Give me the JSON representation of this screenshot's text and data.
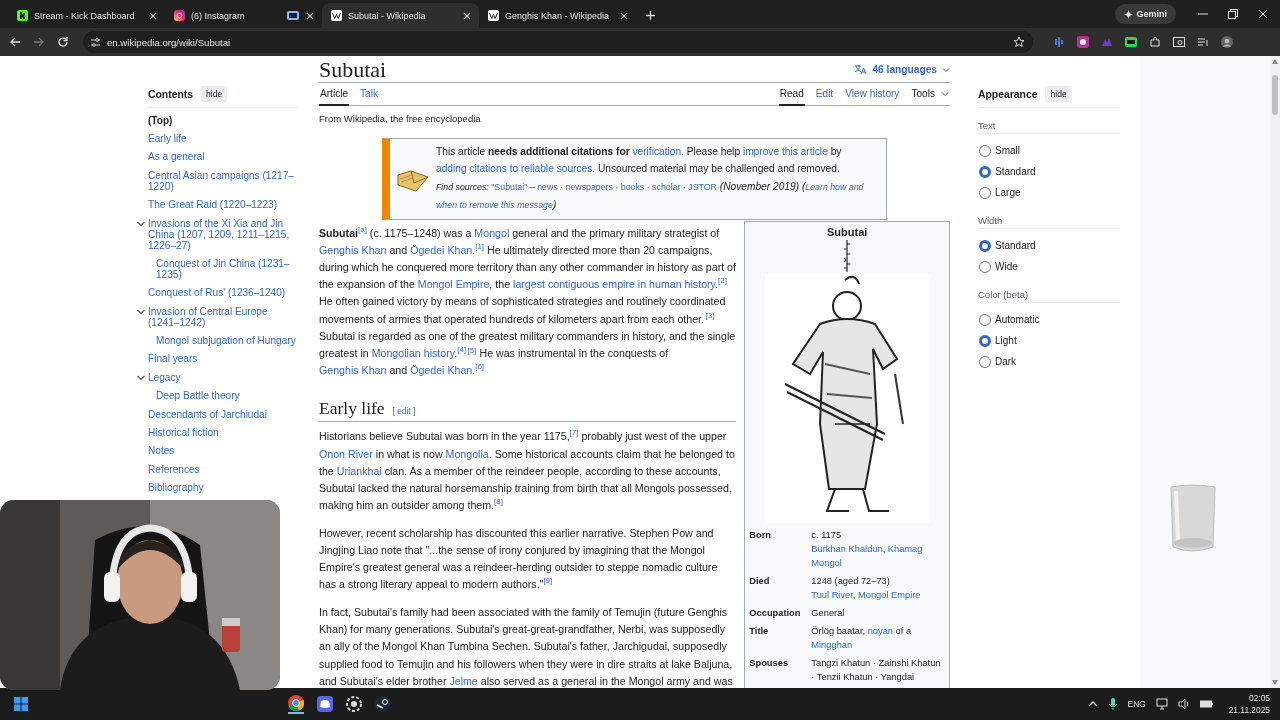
{
  "browser": {
    "tabs": [
      {
        "kind": "kick",
        "title": "Stream - Kick Dashboard",
        "selected": false,
        "sharing": false
      },
      {
        "kind": "instagram",
        "title": "(6) Instagram",
        "selected": false,
        "sharing": true
      },
      {
        "kind": "wikipedia",
        "title": "Subutai - Wikipedia",
        "selected": true,
        "sharing": false
      },
      {
        "kind": "wikipedia",
        "title": "Genghis Khan - Wikipedia",
        "selected": false,
        "sharing": false
      }
    ],
    "assistant_button": "Gemini",
    "url": "en.wikipedia.org/wiki/Subutai"
  },
  "toc": {
    "title": "Contents",
    "hide_button": "hide",
    "items": [
      {
        "label": "(Top)",
        "selected": true
      },
      {
        "label": "Early life",
        "selected": false
      },
      {
        "label": "As a general",
        "selected": false
      },
      {
        "label": "Central Asian campaigns (1217–1220)",
        "selected": false
      },
      {
        "label": "The Great Raid (1220–1223)",
        "selected": false
      },
      {
        "label": "Invasions of the Xi Xia and Jin China (1207, 1209, 1211–1215, 1226–27)",
        "selected": false,
        "expanded": true,
        "children": [
          {
            "label": "Conquest of Jin China (1231–1235)",
            "selected": false
          }
        ]
      },
      {
        "label": "Conquest of Rus' (1236–1240)",
        "selected": false
      },
      {
        "label": "Invasion of Central Europe (1241–1242)",
        "selected": false,
        "expanded": true,
        "children": [
          {
            "label": "Mongol subjugation of Hungary",
            "selected": false
          }
        ]
      },
      {
        "label": "Final years",
        "selected": false
      },
      {
        "label": "Legacy",
        "selected": false,
        "expanded": true,
        "children": [
          {
            "label": "Deep Battle theory",
            "selected": false
          }
        ]
      },
      {
        "label": "Descendants of Jarchiudai",
        "selected": false
      },
      {
        "label": "Historical fiction",
        "selected": false
      },
      {
        "label": "Notes",
        "selected": false
      },
      {
        "label": "References",
        "selected": false
      },
      {
        "label": "Bibliography",
        "selected": false
      }
    ]
  },
  "article": {
    "title": "Subutai",
    "languages": "46 languages",
    "namespace_tabs": [
      {
        "label": "Article",
        "selected": true
      },
      {
        "label": "Talk",
        "selected": false
      }
    ],
    "view_tabs": [
      {
        "label": "Read",
        "selected": true,
        "kind": "tab"
      },
      {
        "label": "Edit",
        "selected": false,
        "kind": "tab"
      },
      {
        "label": "View history",
        "selected": false,
        "kind": "tab"
      },
      {
        "label": "Tools",
        "selected": false,
        "kind": "menu"
      }
    ],
    "tagline": "From Wikipedia, the free encyclopedia",
    "notice": {
      "message": [
        {
          "kind": "plain",
          "text": "This article "
        },
        {
          "kind": "bold",
          "text": "needs additional citations for "
        },
        {
          "kind": "link",
          "text": "verification"
        },
        {
          "kind": "plain",
          "text": ". Please help "
        },
        {
          "kind": "link",
          "text": "improve this article"
        },
        {
          "kind": "plain",
          "text": " by "
        },
        {
          "kind": "link",
          "text": "adding citations to reliable sources"
        },
        {
          "kind": "plain",
          "text": ". Unsourced material may be challenged and removed."
        }
      ],
      "sources": [
        {
          "kind": "italic",
          "text": "Find sources: "
        },
        {
          "kind": "link",
          "text": "\"Subutai\""
        },
        {
          "kind": "plain",
          "text": " – "
        },
        {
          "kind": "link",
          "text": "news"
        },
        {
          "kind": "plain",
          "text": " · "
        },
        {
          "kind": "link",
          "text": "newspapers"
        },
        {
          "kind": "plain",
          "text": " · "
        },
        {
          "kind": "link",
          "text": "books"
        },
        {
          "kind": "plain",
          "text": " · "
        },
        {
          "kind": "link",
          "text": "scholar"
        },
        {
          "kind": "plain",
          "text": " · "
        },
        {
          "kind": "link",
          "text": "JSTOR"
        },
        {
          "kind": "italic-big",
          "text": " (November 2019) ("
        },
        {
          "kind": "italic-link",
          "text": "Learn how and"
        },
        {
          "kind": "space"
        },
        {
          "kind": "italic-link",
          "text": "when to remove this message"
        },
        {
          "kind": "italic-big",
          "text": ")"
        }
      ]
    },
    "lead": [
      {
        "kind": "bold",
        "text": "Subutai"
      },
      {
        "kind": "ref",
        "text": "[a]"
      },
      {
        "kind": "plain",
        "text": " (c. 1175–1248) was a "
      },
      {
        "kind": "link",
        "text": "Mongol"
      },
      {
        "kind": "plain",
        "text": " general and the primary military strategist of "
      },
      {
        "kind": "link",
        "text": "Genghis Khan"
      },
      {
        "kind": "plain",
        "text": " and "
      },
      {
        "kind": "link",
        "text": "Ögedei Khan"
      },
      {
        "kind": "plain",
        "text": "."
      },
      {
        "kind": "ref",
        "text": "[1]"
      },
      {
        "kind": "plain",
        "text": " He ultimately directed more than 20 campaigns, during which he conquered more territory than any other commander in history as part of the expansion of the "
      },
      {
        "kind": "link",
        "text": "Mongol Empire"
      },
      {
        "kind": "plain",
        "text": ", the "
      },
      {
        "kind": "link",
        "text": "largest contiguous empire in human"
      },
      {
        "kind": "space"
      },
      {
        "kind": "link",
        "text": "history"
      },
      {
        "kind": "plain",
        "text": "."
      },
      {
        "kind": "ref",
        "text": "[2]"
      },
      {
        "kind": "plain",
        "text": " He often gained victory by means of sophisticated strategies and routinely coordinated movements of armies that operated hundreds of kilometers apart from each other."
      },
      {
        "kind": "ref",
        "text": "[3]"
      },
      {
        "kind": "plain",
        "text": " Subutai is regarded as one of the greatest military commanders in history, and the single greatest in "
      },
      {
        "kind": "link",
        "text": "Mongolian history"
      },
      {
        "kind": "plain",
        "text": "."
      },
      {
        "kind": "ref",
        "text": "[4]"
      },
      {
        "kind": "ref",
        "text": "[5]"
      },
      {
        "kind": "plain",
        "text": " He was instrumental in the conquests of "
      },
      {
        "kind": "link",
        "text": "Genghis Khan"
      },
      {
        "kind": "plain",
        "text": " and "
      },
      {
        "kind": "link",
        "text": "Ögedei Khan"
      },
      {
        "kind": "plain",
        "text": "."
      },
      {
        "kind": "ref",
        "text": "[6]"
      }
    ],
    "sections": [
      {
        "heading": "Early life",
        "edit_link": "[ edit ]",
        "paragraphs": [
          [
            {
              "kind": "plain",
              "text": "Historians believe Subutai was born in the year 1175,"
            },
            {
              "kind": "ref",
              "text": "[7]"
            },
            {
              "kind": "plain",
              "text": " probably just west of the upper "
            },
            {
              "kind": "link",
              "text": "Onon River"
            },
            {
              "kind": "plain",
              "text": " in what is now "
            },
            {
              "kind": "link",
              "text": "Mongolia"
            },
            {
              "kind": "plain",
              "text": ". Some historical accounts claim that he belonged to the "
            },
            {
              "kind": "link",
              "text": "Uriankhai"
            },
            {
              "kind": "plain",
              "text": " clan. As a member of the reindeer people, according to these accounts, Subutai lacked the natural horsemanship training from birth that all Mongols possessed, making him an outsider among them."
            },
            {
              "kind": "ref",
              "text": "[8]"
            }
          ],
          [
            {
              "kind": "plain",
              "text": "However, recent scholarship has discounted this earlier narrative. Stephen Pow and Jingjing Liao note that \"...the sense of irony conjured by imagining that the Mongol Empire's greatest general was a reindeer-herding outsider to steppe nomadic culture has a strong literary appeal to modern authors.\""
            },
            {
              "kind": "ref",
              "text": "[9]"
            }
          ],
          [
            {
              "kind": "plain",
              "text": "In fact, Subutai's family had been associated with the family of Temujin (future Genghis Khan) for many generations. Subutai's great-great-grandfather, Nerbi, was supposedly an ally of the Mongol Khan Tumbina Sechen. Subutai's father, Jarchigudai, supposedly supplied food to Temujin and his followers when they were in dire straits at lake Baljuna, and Subutai's elder brother "
            },
            {
              "kind": "link",
              "text": "Jelme"
            },
            {
              "kind": "plain",
              "text": " also served as a general in the Mongol army and was"
            }
          ]
        ]
      }
    ]
  },
  "infobox": {
    "title": "Subutai",
    "rows": [
      {
        "label": "Born",
        "lines": [
          [
            {
              "kind": "plain",
              "text": "c. 1175"
            }
          ],
          [
            {
              "kind": "link",
              "text": "Burkhan Khaldun"
            },
            {
              "kind": "plain",
              "text": ", "
            },
            {
              "kind": "link",
              "text": "Khamag"
            },
            {
              "kind": "space"
            },
            {
              "kind": "link",
              "text": "Mongol"
            }
          ]
        ]
      },
      {
        "label": "Died",
        "lines": [
          [
            {
              "kind": "plain",
              "text": "1248 (aged 72–73)"
            }
          ],
          [
            {
              "kind": "link",
              "text": "Tuul River"
            },
            {
              "kind": "plain",
              "text": ", "
            },
            {
              "kind": "link",
              "text": "Mongol Empire"
            }
          ]
        ]
      },
      {
        "label": "Occupation",
        "lines": [
          [
            {
              "kind": "plain",
              "text": "General"
            }
          ]
        ]
      },
      {
        "label": "Title",
        "lines": [
          [
            {
              "kind": "plain",
              "text": "Örlög baatar, "
            },
            {
              "kind": "link",
              "text": "noyan"
            },
            {
              "kind": "plain",
              "text": " of a "
            },
            {
              "kind": "link",
              "text": "Mingghan"
            }
          ]
        ]
      },
      {
        "label": "Spouses",
        "lines": [
          [
            {
              "kind": "plain",
              "text": "Tangzi Khatun · Zainshi Khatun · Tenzii Khatun · Yangdai"
            }
          ]
        ]
      }
    ]
  },
  "appearance": {
    "title": "Appearance",
    "hide_button": "hide",
    "groups": [
      {
        "label": "Text",
        "options": [
          {
            "label": "Small",
            "selected": false
          },
          {
            "label": "Standard",
            "selected": true
          },
          {
            "label": "Large",
            "selected": false
          }
        ]
      },
      {
        "label": "Width",
        "options": [
          {
            "label": "Standard",
            "selected": true
          },
          {
            "label": "Wide",
            "selected": false
          }
        ]
      },
      {
        "label": "Color (beta)",
        "options": [
          {
            "label": "Automatic",
            "selected": false
          },
          {
            "label": "Light",
            "selected": true
          },
          {
            "label": "Dark",
            "selected": false
          }
        ]
      }
    ]
  },
  "taskbar": {
    "language": "ENG",
    "time": "02:05",
    "date": "21.11.2025"
  }
}
